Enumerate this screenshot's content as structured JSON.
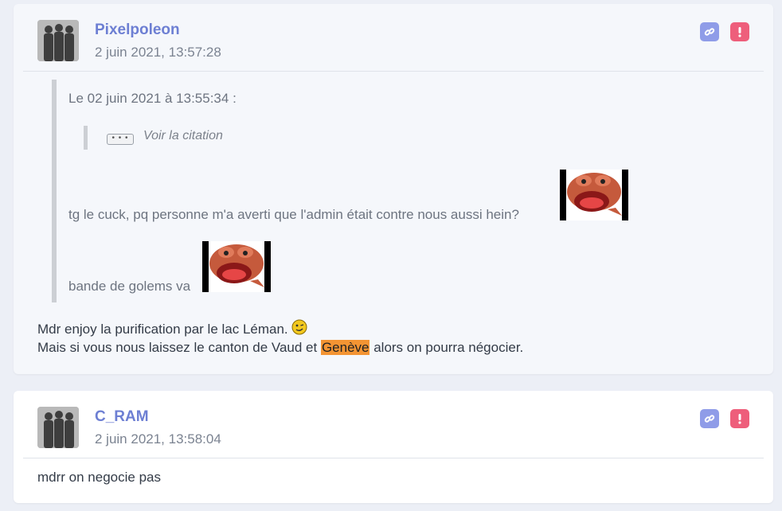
{
  "posts": [
    {
      "username": "Pixelpoleon",
      "date": "2 juin 2021, 13:57:28",
      "quote": {
        "header": "Le 02 juin 2021 à 13:55:34 :",
        "nested_label": "Voir la citation",
        "lines": [
          "tg le cuck, pq personne m'a averti que l'admin était contre nous aussi hein?",
          "bande de golems va"
        ]
      },
      "body": {
        "line1": "Mdr enjoy la purification par le lac Léman.",
        "line2_before": "Mais si vous nous laissez le canton de Vaud et ",
        "line2_highlight": "Genève",
        "line2_after": " alors on pourra négocier."
      }
    },
    {
      "username": "C_RAM",
      "date": "2 juin 2021, 13:58:04",
      "body": {
        "line1": "mdrr on negocie pas"
      }
    }
  ],
  "icons": {
    "link": "link-icon",
    "report": "exclamation-icon",
    "avatar": "silhouettes-avatar",
    "sticker": "angry-pepe-sticker",
    "smiley": "winking-smiley-icon"
  },
  "colors": {
    "username": "#6d7fd3",
    "link_button": "#8f9ce8",
    "report_button": "#ee5e7b",
    "highlight": "#f39433"
  }
}
